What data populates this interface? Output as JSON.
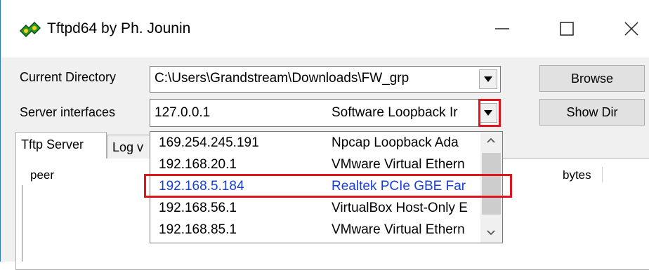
{
  "window": {
    "title": "Tftpd64 by Ph. Jounin"
  },
  "current_directory": {
    "label": "Current Directory",
    "value": "C:\\Users\\Grandstream\\Downloads\\FW_grp"
  },
  "server_interfaces": {
    "label": "Server interfaces",
    "ip": "127.0.0.1",
    "name": "Software Loopback Ir"
  },
  "buttons": {
    "browse": "Browse",
    "show_dir": "Show Dir"
  },
  "tabs": [
    "Tftp Server",
    "Log v"
  ],
  "columns": {
    "peer": "peer",
    "bytes": "bytes"
  },
  "interface_options": [
    {
      "ip": "169.254.245.191",
      "name": "Npcap Loopback Ada"
    },
    {
      "ip": "192.168.20.1",
      "name": "VMware Virtual Ethern"
    },
    {
      "ip": "192.168.5.184",
      "name": "Realtek PCIe GBE Far"
    },
    {
      "ip": "192.168.56.1",
      "name": "VirtualBox Host-Only E"
    },
    {
      "ip": "192.168.85.1",
      "name": "VMware Virtual Ethern"
    }
  ],
  "colors": {
    "highlight": "#e0141b",
    "selected_text": "#1a3fd6"
  }
}
